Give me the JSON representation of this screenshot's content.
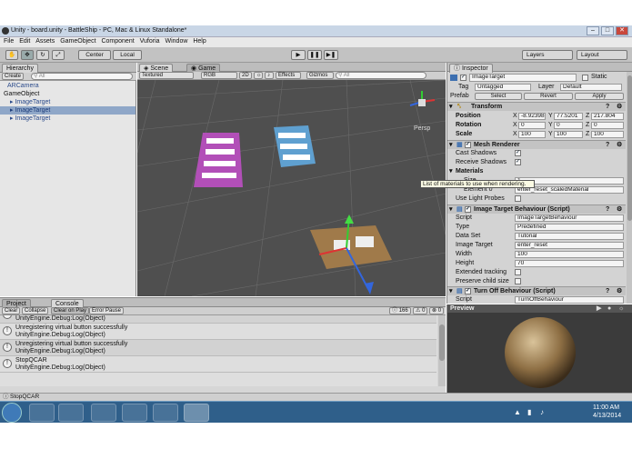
{
  "titlebar": {
    "title": "Unity - board.unity - BattleShip - PC, Mac & Linux Standalone*",
    "min": "–",
    "max": "□",
    "close": "✕"
  },
  "menu": [
    "File",
    "Edit",
    "Assets",
    "GameObject",
    "Component",
    "Vuforia",
    "Window",
    "Help"
  ],
  "toolbar": {
    "center": "Center",
    "local": "Local",
    "layers": "Layers",
    "layout": "Layout"
  },
  "hierarchy": {
    "tab": "Hierarchy",
    "create": "Create",
    "search_placeholder": "All",
    "items": [
      "ARCamera",
      "GameObject",
      "ImageTarget",
      "ImageTarget",
      "ImageTarget"
    ]
  },
  "scene": {
    "tab_scene": "Scene",
    "tab_game": "Game",
    "shading": "Textured",
    "render": "RGB",
    "mode": "2D",
    "effects": "Effects",
    "gizmos": "Gizmos",
    "search_placeholder": "All",
    "persp": "Persp"
  },
  "console": {
    "tab_project": "Project",
    "tab_console": "Console",
    "clear": "Clear",
    "collapse": "Collapse",
    "clear_on_play": "Clear on Play",
    "error_pause": "Error Pause",
    "count_info": "166",
    "count_warn": "0",
    "count_error": "0",
    "rows": [
      {
        "msg": "",
        "src": "UnityEngine.Debug:Log(Object)"
      },
      {
        "msg": "Unregistering virtual button successfully",
        "src": "UnityEngine.Debug:Log(Object)"
      },
      {
        "msg": "Unregistering virtual button successfully",
        "src": "UnityEngine.Debug:Log(Object)"
      },
      {
        "msg": "StopQCAR",
        "src": "UnityEngine.Debug:Log(Object)"
      }
    ]
  },
  "inspector": {
    "tab": "Inspector",
    "name": "ImageTarget",
    "static": "Static",
    "tag_label": "Tag",
    "tag": "Untagged",
    "layer_label": "Layer",
    "layer": "Default",
    "prefab": "Prefab",
    "select": "Select",
    "revert": "Revert",
    "apply": "Apply",
    "transform": {
      "title": "Transform",
      "position": {
        "label": "Position",
        "x": "-8.92398",
        "y": "77.5201",
        "z": "217.804"
      },
      "rotation": {
        "label": "Rotation",
        "x": "0",
        "y": "0",
        "z": "0"
      },
      "scale": {
        "label": "Scale",
        "x": "100",
        "y": "100",
        "z": "100"
      }
    },
    "mesh_renderer": {
      "title": "Mesh Renderer",
      "cast_shadows": "Cast Shadows",
      "receive_shadows": "Receive Shadows",
      "materials": "Materials",
      "size": "Size",
      "size_value": "1",
      "element0": "Element 0",
      "element0_value": "enter_reset_scaledMaterial",
      "use_light_probes": "Use Light Probes"
    },
    "tooltip": "List of materials to use when rendering.",
    "itb": {
      "title": "Image Target Behaviour (Script)",
      "script": "Script",
      "script_value": "ImageTargetBehaviour",
      "type": "Type",
      "type_value": "Predefined",
      "data_set": "Data Set",
      "data_set_value": "Tutorial",
      "image_target": "Image Target",
      "image_target_value": "enter_reset",
      "width": "Width",
      "width_value": "100",
      "height": "Height",
      "height_value": "70",
      "extended_tracking": "Extended tracking",
      "preserve_child": "Preserve child size"
    },
    "tob": {
      "title": "Turn Off Behaviour (Script)",
      "script": "Script",
      "script_value": "TurnOffBehaviour"
    }
  },
  "preview": {
    "label": "Preview"
  },
  "status": {
    "text": "StopQCAR"
  },
  "taskbar": {
    "time": "11:00 AM",
    "date": "4/13/2014"
  },
  "colors": {
    "accent": "#3d6fb0",
    "selected_row": "#8fa7c8"
  }
}
